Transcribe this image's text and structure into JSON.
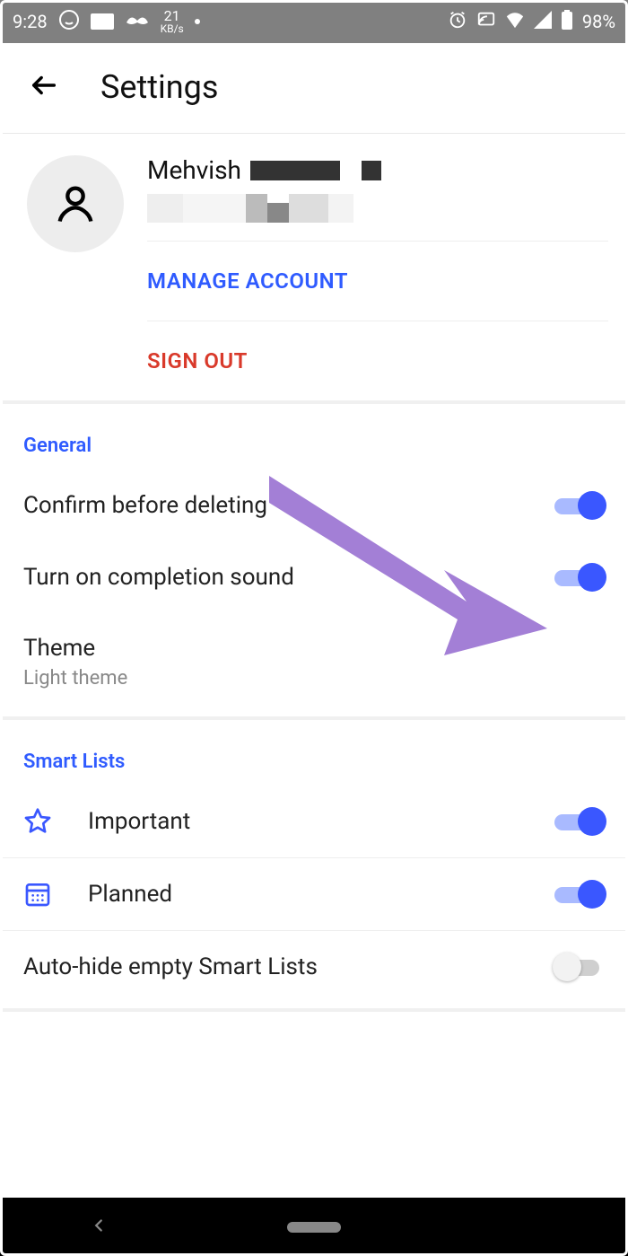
{
  "statusbar": {
    "time": "9:28",
    "speed_num": "21",
    "speed_unit": "KB/s",
    "battery": "98%"
  },
  "appbar": {
    "title": "Settings"
  },
  "account": {
    "name": "Mehvish",
    "manage": "MANAGE ACCOUNT",
    "signout": "SIGN OUT"
  },
  "general": {
    "header": "General",
    "confirm_delete": "Confirm before deleting",
    "completion_sound": "Turn on completion sound",
    "theme_label": "Theme",
    "theme_value": "Light theme"
  },
  "smartlists": {
    "header": "Smart Lists",
    "important": "Important",
    "planned": "Planned",
    "autohide": "Auto-hide empty Smart Lists"
  }
}
